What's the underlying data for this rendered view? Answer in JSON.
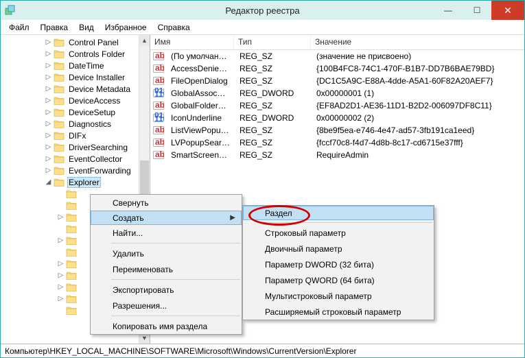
{
  "title": "Редактор реестра",
  "menubar": [
    "Файл",
    "Правка",
    "Вид",
    "Избранное",
    "Справка"
  ],
  "tree": [
    {
      "indent": 64,
      "exp": "▷",
      "label": "Control Panel"
    },
    {
      "indent": 64,
      "exp": "▷",
      "label": "Controls Folder"
    },
    {
      "indent": 64,
      "exp": "▷",
      "label": "DateTime"
    },
    {
      "indent": 64,
      "exp": "▷",
      "label": "Device Installer"
    },
    {
      "indent": 64,
      "exp": "▷",
      "label": "Device Metadata"
    },
    {
      "indent": 64,
      "exp": "▷",
      "label": "DeviceAccess"
    },
    {
      "indent": 64,
      "exp": "▷",
      "label": "DeviceSetup"
    },
    {
      "indent": 64,
      "exp": "▷",
      "label": "Diagnostics"
    },
    {
      "indent": 64,
      "exp": "▷",
      "label": "DIFx"
    },
    {
      "indent": 64,
      "exp": "▷",
      "label": "DriverSearching"
    },
    {
      "indent": 64,
      "exp": "▷",
      "label": "EventCollector"
    },
    {
      "indent": 64,
      "exp": "▷",
      "label": "EventForwarding"
    },
    {
      "indent": 64,
      "exp": "◢",
      "label": "Explorer",
      "selected": true
    },
    {
      "indent": 82,
      "exp": "",
      "label": ""
    },
    {
      "indent": 82,
      "exp": "",
      "label": ""
    },
    {
      "indent": 82,
      "exp": "▷",
      "label": ""
    },
    {
      "indent": 82,
      "exp": "",
      "label": ""
    },
    {
      "indent": 82,
      "exp": "▷",
      "label": ""
    },
    {
      "indent": 82,
      "exp": "",
      "label": ""
    },
    {
      "indent": 82,
      "exp": "▷",
      "label": ""
    },
    {
      "indent": 82,
      "exp": "▷",
      "label": ""
    },
    {
      "indent": 82,
      "exp": "▷",
      "label": ""
    },
    {
      "indent": 82,
      "exp": "▷",
      "label": ""
    },
    {
      "indent": 82,
      "exp": "",
      "label": ""
    }
  ],
  "columns": {
    "name": "Имя",
    "type": "Тип",
    "value": "Значение"
  },
  "rows": [
    {
      "icon": "ab",
      "name": "(По умолчанию)",
      "type": "REG_SZ",
      "value": "(значение не присвоено)"
    },
    {
      "icon": "ab",
      "name": "AccessDeniedDi...",
      "type": "REG_SZ",
      "value": "{100B4FC8-74C1-470F-B1B7-DD7B6BAE79BD}"
    },
    {
      "icon": "ab",
      "name": "FileOpenDialog",
      "type": "REG_SZ",
      "value": "{DC1C5A9C-E88A-4dde-A5A1-60F82A20AEF7}"
    },
    {
      "icon": "bin",
      "name": "GlobalAssocCha...",
      "type": "REG_DWORD",
      "value": "0x00000001 (1)"
    },
    {
      "icon": "ab",
      "name": "GlobalFolderSett...",
      "type": "REG_SZ",
      "value": "{EF8AD2D1-AE36-11D1-B2D2-006097DF8C11}"
    },
    {
      "icon": "bin",
      "name": "IconUnderline",
      "type": "REG_DWORD",
      "value": "0x00000002 (2)"
    },
    {
      "icon": "ab",
      "name": "ListViewPopupC...",
      "type": "REG_SZ",
      "value": "{8be9f5ea-e746-4e47-ad57-3fb191ca1eed}"
    },
    {
      "icon": "ab",
      "name": "LVPopupSearch...",
      "type": "REG_SZ",
      "value": "{fccf70c8-f4d7-4d8b-8c17-cd6715e37fff}"
    },
    {
      "icon": "ab",
      "name": "SmartScreenEna...",
      "type": "REG_SZ",
      "value": "RequireAdmin"
    }
  ],
  "context1": {
    "items": [
      {
        "label": "Свернуть"
      },
      {
        "label": "Создать",
        "sub": true,
        "hover": true
      },
      {
        "label": "Найти..."
      },
      {
        "sep": true
      },
      {
        "label": "Удалить"
      },
      {
        "label": "Переименовать"
      },
      {
        "sep": true
      },
      {
        "label": "Экспортировать"
      },
      {
        "label": "Разрешения..."
      },
      {
        "sep": true
      },
      {
        "label": "Копировать имя раздела"
      }
    ]
  },
  "context2": {
    "items": [
      {
        "label": "Раздел",
        "hover": true
      },
      {
        "sep": true
      },
      {
        "label": "Строковый параметр"
      },
      {
        "label": "Двоичный параметр"
      },
      {
        "label": "Параметр DWORD (32 бита)"
      },
      {
        "label": "Параметр QWORD (64 бита)"
      },
      {
        "label": "Мультистроковый параметр"
      },
      {
        "label": "Расширяемый строковый параметр"
      }
    ]
  },
  "statusbar": "Компьютер\\HKEY_LOCAL_MACHINE\\SOFTWARE\\Microsoft\\Windows\\CurrentVersion\\Explorer"
}
